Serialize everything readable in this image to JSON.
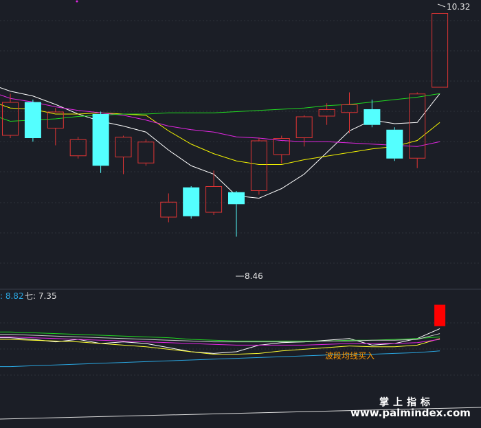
{
  "chart_data": {
    "type": "candlestick",
    "main_panel": {
      "ylim": [
        8.2,
        10.4
      ],
      "annotations": {
        "high_label": "10.32",
        "low_label": "8.46"
      },
      "candles": [
        {
          "o": 9.3,
          "c": 9.58,
          "h": 9.65,
          "l": 9.28
        },
        {
          "o": 9.58,
          "c": 9.28,
          "h": 9.6,
          "l": 9.25
        },
        {
          "o": 9.36,
          "c": 9.5,
          "h": 9.53,
          "l": 9.22
        },
        {
          "o": 9.13,
          "c": 9.27,
          "h": 9.29,
          "l": 9.11
        },
        {
          "o": 9.48,
          "c": 9.05,
          "h": 9.5,
          "l": 8.99
        },
        {
          "o": 9.12,
          "c": 9.29,
          "h": 9.3,
          "l": 8.98
        },
        {
          "o": 9.07,
          "c": 9.25,
          "h": 9.27,
          "l": 9.05
        },
        {
          "o": 8.62,
          "c": 8.75,
          "h": 8.82,
          "l": 8.58
        },
        {
          "o": 8.87,
          "c": 8.63,
          "h": 8.88,
          "l": 8.61
        },
        {
          "o": 8.66,
          "c": 8.88,
          "h": 9.01,
          "l": 8.64
        },
        {
          "o": 8.83,
          "c": 8.73,
          "h": 8.84,
          "l": 8.46
        },
        {
          "o": 8.84,
          "c": 9.26,
          "h": 9.28,
          "l": 8.81
        },
        {
          "o": 9.14,
          "c": 9.28,
          "h": 9.3,
          "l": 9.07
        },
        {
          "o": 9.28,
          "c": 9.46,
          "h": 9.47,
          "l": 9.21
        },
        {
          "o": 9.46,
          "c": 9.52,
          "h": 9.57,
          "l": 9.39
        },
        {
          "o": 9.49,
          "c": 9.56,
          "h": 9.66,
          "l": 9.32
        },
        {
          "o": 9.52,
          "c": 9.39,
          "h": 9.6,
          "l": 9.37
        },
        {
          "o": 9.35,
          "c": 9.11,
          "h": 9.37,
          "l": 9.09
        },
        {
          "o": 9.11,
          "c": 9.65,
          "h": 9.66,
          "l": 9.03
        },
        {
          "o": 9.7,
          "c": 10.32,
          "h": 10.32,
          "l": 9.7
        }
      ],
      "ma_lines": [
        {
          "color": "#ffffff",
          "values": [
            9.67,
            9.63,
            9.56,
            9.48,
            9.42,
            9.38,
            9.33,
            9.18,
            9.05,
            8.98,
            8.8,
            8.78,
            8.86,
            8.98,
            9.16,
            9.34,
            9.43,
            9.4,
            9.41,
            9.65
          ]
        },
        {
          "color": "#f5f500",
          "values": [
            9.53,
            9.52,
            9.48,
            9.48,
            9.49,
            9.48,
            9.47,
            9.34,
            9.23,
            9.15,
            9.09,
            9.06,
            9.06,
            9.1,
            9.13,
            9.16,
            9.19,
            9.21,
            9.26,
            9.41
          ]
        },
        {
          "color": "#e426e4",
          "values": [
            9.61,
            9.58,
            9.54,
            9.51,
            9.49,
            9.47,
            9.43,
            9.38,
            9.35,
            9.33,
            9.29,
            9.28,
            9.26,
            9.25,
            9.25,
            9.24,
            9.23,
            9.22,
            9.21,
            9.25
          ]
        },
        {
          "color": "#21d921",
          "values": [
            9.42,
            9.43,
            9.44,
            9.46,
            9.47,
            9.48,
            9.48,
            9.49,
            9.49,
            9.49,
            9.5,
            9.51,
            9.52,
            9.53,
            9.55,
            9.56,
            9.58,
            9.6,
            9.62,
            9.65
          ]
        }
      ]
    },
    "sub_panel": {
      "ylim": [
        0,
        100
      ],
      "legend": [
        {
          "text": ": 8.82",
          "color": "#2aa6e0"
        },
        {
          "text": "七: 7.35",
          "color": "#dddddd"
        }
      ],
      "signal_bar_index": 19,
      "signal_bar_range": [
        71,
        97
      ],
      "annotation": {
        "text": "波段均线买入",
        "color": "#ff9900"
      },
      "lines": [
        {
          "color": "#ffffff",
          "values": [
            57,
            55,
            52,
            55,
            50,
            52,
            50,
            45,
            40,
            38,
            40,
            48,
            51,
            52,
            54,
            56,
            48,
            50,
            56,
            68
          ]
        },
        {
          "color": "#ffff33",
          "values": [
            55,
            54,
            53,
            52,
            50,
            48,
            46,
            43,
            40,
            37,
            37,
            38,
            41,
            43,
            45,
            47,
            46,
            46,
            48,
            56
          ]
        },
        {
          "color": "#e426e4",
          "values": [
            58,
            57,
            56,
            55,
            54,
            53,
            52,
            51,
            50,
            49,
            48,
            48,
            48,
            48,
            49,
            50,
            50,
            50,
            51,
            55
          ]
        },
        {
          "color": "#21d921",
          "values": [
            64,
            63,
            62,
            61,
            60,
            59,
            58,
            57,
            55,
            54,
            53,
            53,
            53,
            53,
            53,
            54,
            54,
            55,
            56,
            58
          ]
        },
        {
          "color": "#cccccc",
          "values": [
            61,
            60,
            59,
            58,
            57,
            56,
            55,
            54,
            53,
            52,
            52,
            52,
            52,
            52,
            53,
            53,
            54,
            54,
            55,
            62
          ]
        },
        {
          "color": "#2aa6e0",
          "values": [
            22,
            23,
            24,
            25,
            26,
            27,
            28,
            29,
            30,
            31,
            32,
            33,
            34,
            35,
            36,
            37,
            37,
            38,
            39,
            41
          ]
        }
      ]
    }
  },
  "watermark": {
    "line1": "掌上指标",
    "line2": "www.palmindex.com"
  }
}
